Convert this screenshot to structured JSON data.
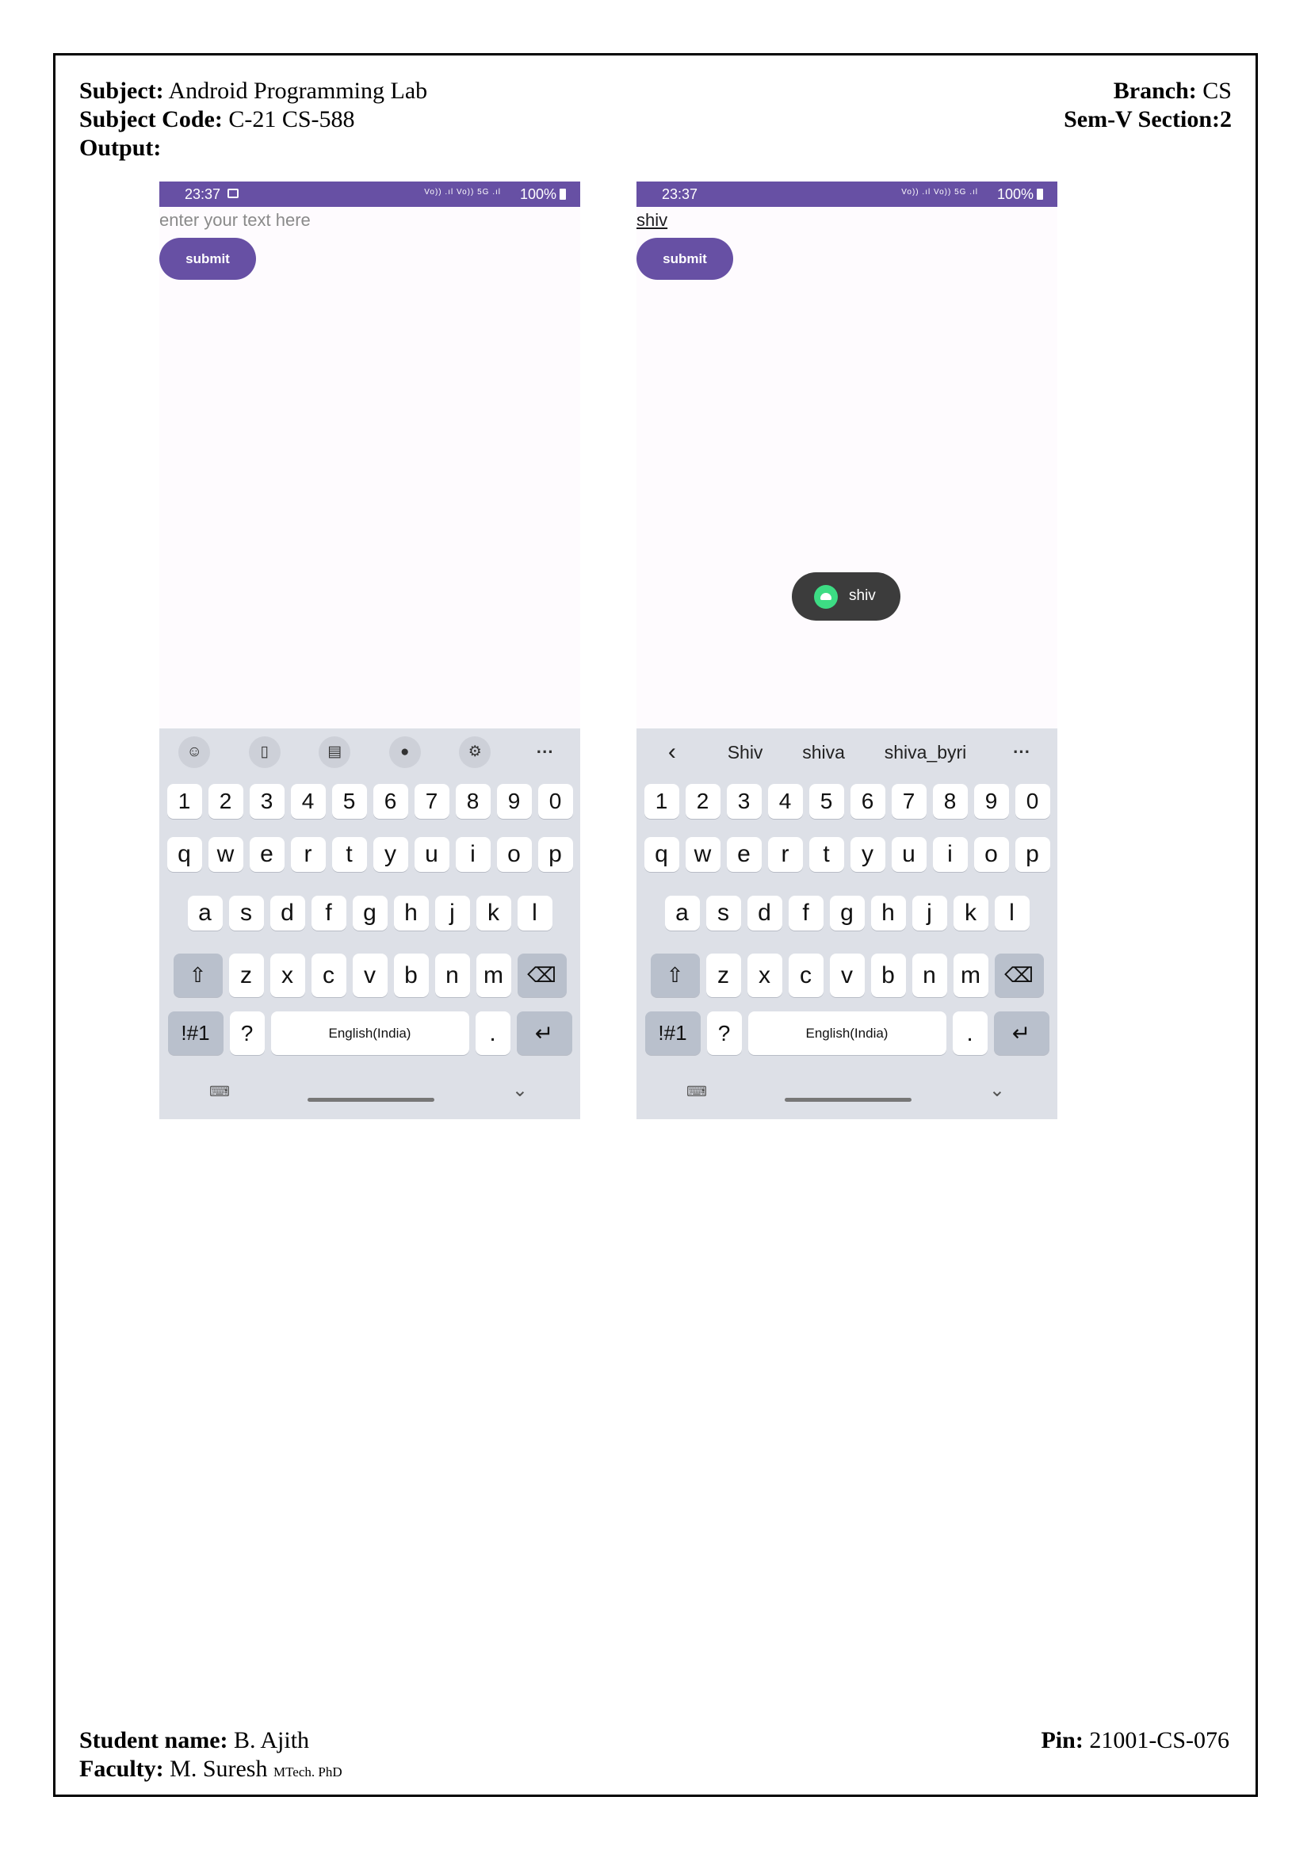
{
  "header": {
    "subject_label": "Subject:",
    "subject": "Android Programming Lab",
    "code_label": "Subject Code:",
    "code": "C-21 CS-588",
    "output_label": "Output:",
    "branch_label": "Branch:",
    "branch": "CS",
    "sem_section": "Sem-V Section:2"
  },
  "footer": {
    "student_label": "Student name:",
    "student": "B. Ajith",
    "faculty_label": "Faculty:",
    "faculty": "M. Suresh",
    "faculty_degree": "MTech. PhD",
    "pin_label": "Pin:",
    "pin": "21001-CS-076"
  },
  "phone1": {
    "time": "23:37",
    "signal": "Vo)) .ıl Vo)) 5G .ıl",
    "battery": "100%",
    "input_placeholder": "enter your text here",
    "button": "submit",
    "toolbar_icons": [
      "emoji-icon",
      "clipboard-icon",
      "sticker-icon",
      "mic-icon",
      "settings-icon",
      "more-icon"
    ]
  },
  "phone2": {
    "time": "23:37",
    "signal": "Vo)) .ıl Vo)) 5G .ıl",
    "battery": "100%",
    "input_value": "shiv",
    "button": "submit",
    "toast": "shiv",
    "suggestions": [
      "Shiv",
      "shiva",
      "shiva_byri"
    ]
  },
  "keyboard": {
    "numbers": [
      "1",
      "2",
      "3",
      "4",
      "5",
      "6",
      "7",
      "8",
      "9",
      "0"
    ],
    "row_q": [
      "q",
      "w",
      "e",
      "r",
      "t",
      "y",
      "u",
      "i",
      "o",
      "p"
    ],
    "row_a": [
      "a",
      "s",
      "d",
      "f",
      "g",
      "h",
      "j",
      "k",
      "l"
    ],
    "row_z": [
      "z",
      "x",
      "c",
      "v",
      "b",
      "n",
      "m"
    ],
    "sym": "!#1",
    "question": "?",
    "space": "English(India)",
    "dot": ".",
    "more": "···"
  }
}
